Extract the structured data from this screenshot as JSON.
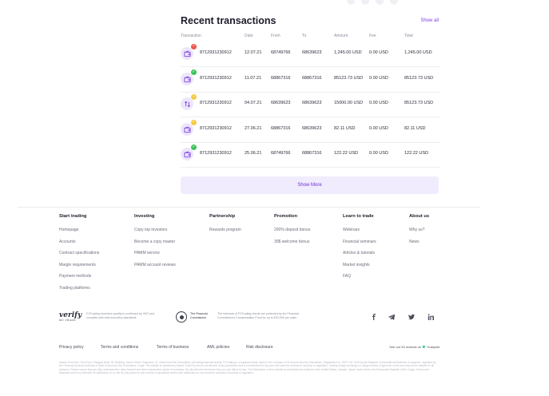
{
  "transactions": {
    "title": "Recent transactions",
    "show_all": "Show all",
    "columns": [
      "Transaction",
      "Date",
      "From",
      "To",
      "Amount",
      "Fee",
      "Total"
    ],
    "rows": [
      {
        "id": "8712931230912",
        "date": "12.07.21",
        "from": "68749766",
        "to": "68639623",
        "amount": "1,245.00 USD",
        "fee": "0.00 USD",
        "total": "1,245.00 USD",
        "status": "failed",
        "icon": "wallet-icon"
      },
      {
        "id": "8712931230912",
        "date": "11.07.21",
        "from": "68867316",
        "to": "68867316",
        "amount": "85123.73 USD",
        "fee": "0.00 USD",
        "total": "85123.73 USD",
        "status": "success",
        "icon": "wallet-icon"
      },
      {
        "id": "8712931230912",
        "date": "04.07.21",
        "from": "68639623",
        "to": "68639623",
        "amount": "15000.00 USD",
        "fee": "0.00 USD",
        "total": "85123.73 USD",
        "status": "pending",
        "icon": "transfer-arrows-icon"
      },
      {
        "id": "8712931230912",
        "date": "27.06.21",
        "from": "68867316",
        "to": "68639623",
        "amount": "82.11 USD",
        "fee": "0.00 USD",
        "total": "82.11 USD",
        "status": "pending",
        "icon": "wallet-icon"
      },
      {
        "id": "8712931230912",
        "date": "25.06.21",
        "from": "68749766",
        "to": "68867316",
        "amount": "122.22 USD",
        "fee": "0.00 USD",
        "total": "122.22 USD",
        "status": "success",
        "icon": "wallet-icon"
      }
    ],
    "show_more": "Show More"
  },
  "footer": {
    "columns": [
      {
        "heading": "Start trading",
        "links": [
          "Homepage",
          "Accounts",
          "Contract specifications",
          "Margin requirements",
          "Payment methods",
          "Trading platforms"
        ]
      },
      {
        "heading": "Investing",
        "links": [
          "Copy top investors",
          "Become a copy master",
          "PAMM service",
          "PAMM account reviews"
        ]
      },
      {
        "heading": "Partnership",
        "links": [
          "Rewards program"
        ]
      },
      {
        "heading": "Promotion",
        "links": [
          "200% deposit bonus",
          "30$ welcome bonus"
        ]
      },
      {
        "heading": "Learn to trade",
        "links": [
          "Webinars",
          "Financial seminars",
          "Articles & tutorials",
          "Market insights",
          "FAQ"
        ]
      },
      {
        "heading": "About us",
        "links": [
          "Why us?",
          "News"
        ]
      }
    ],
    "verify_logo": "verify",
    "verify_sub": "MY TRADE",
    "verify_text": "FXTrading execution quality is confirmed by VMT and complies with best execution standards",
    "fc_name": "The Financial Commission",
    "fc_text": "The interests of FXTrading clients are protected by the Financial Commission's Compensation Fund for up to €20,000 per claim",
    "social_icons": [
      "facebook-icon",
      "telegram-icon",
      "twitter-icon",
      "linkedin-icon"
    ],
    "legal_links": [
      "Privacy policy",
      "Terms and conditions",
      "Terms of business",
      "AML policies",
      "Risk disclosure"
    ],
    "trustpilot_text": "See our 62 reviews on",
    "trustpilot_brand": "Trustpilot",
    "disclaimer": "Adonis Trust Plus, First Floor, Glasgow Bank, SC Building, James Street, Kingstown, St. Vincent and the Grenadines. All trading financial activity, FXTrading is a registered trade name in the Company of St Vincent and the Grenadines. Registration no. 25077 BC 2018 by the Registrar of International Business Companies, regulated by the Financial Services Authority of Saint Vincent and the Grenadines. Legal: The website is operated by Adonis Trust Plus and is not directed at any jurisdiction and is not intended for any use that would be contrary to local law or regulation. Trading foreign exchange on margin carries a high level of risk and may not be suitable for all investors. Please ensure that you fully understand the risks involved and seek independent advice if necessary. You should not invest more than you can afford to lose. The information on this website is not directed at residents of the United States, Canada, Japan, North Korea, the Democratic Republic of the Congo, Yemen and Myanmar and is not intended for distribution to, or use by, any person in any country or jurisdiction where such distribution or use would be contrary to local law or regulation."
  }
}
